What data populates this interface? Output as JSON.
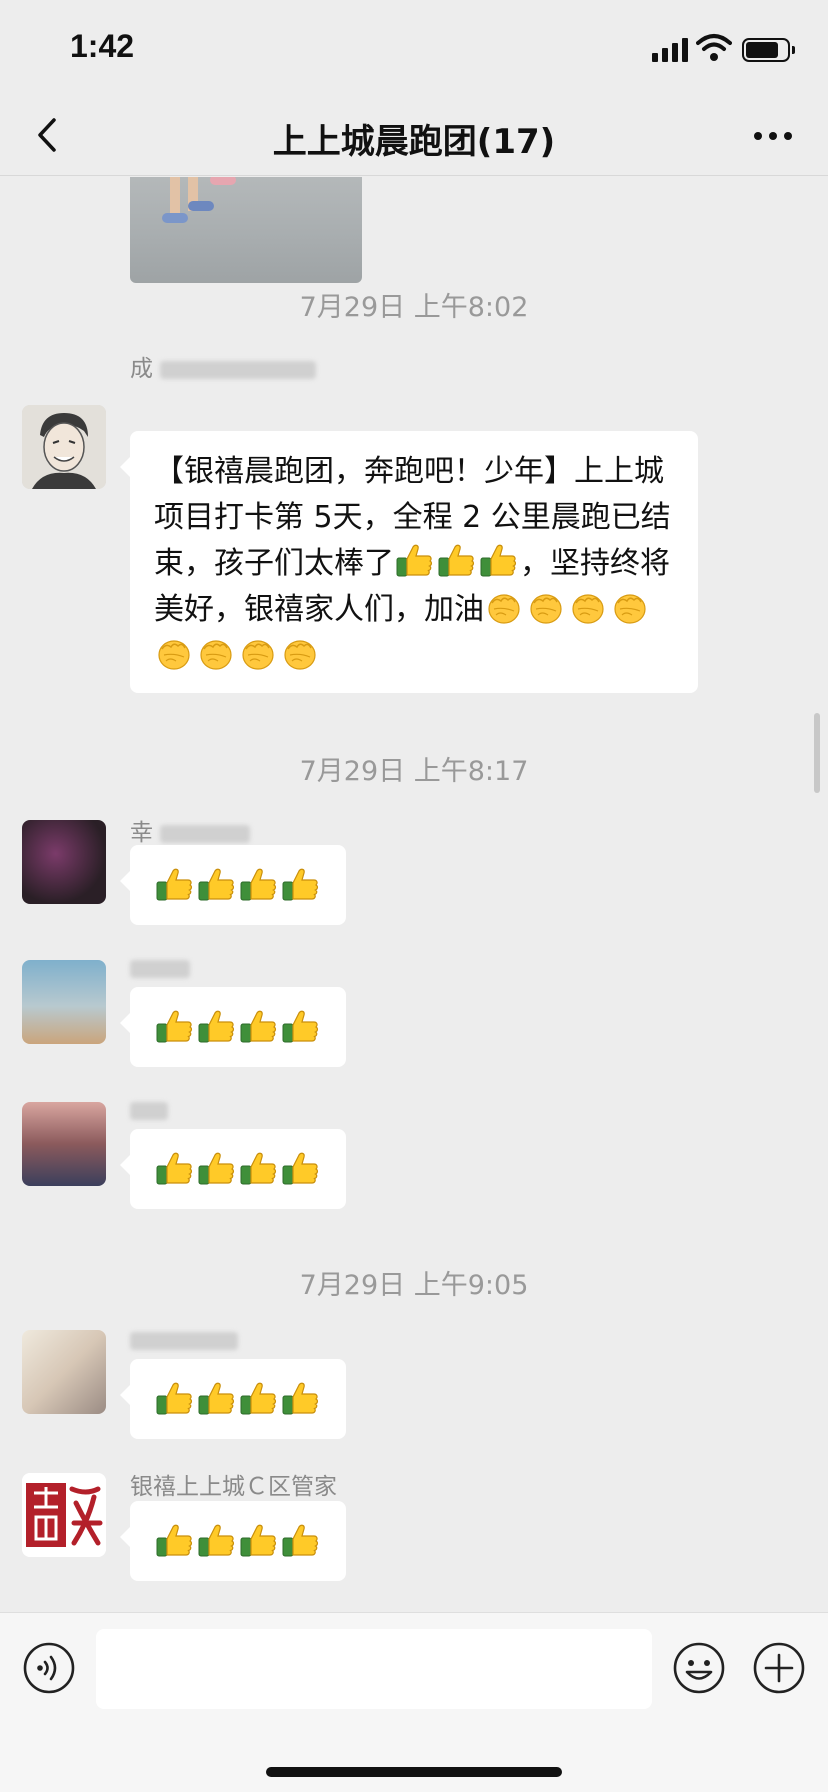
{
  "status_bar": {
    "time": "1:42"
  },
  "nav": {
    "title": "上上城晨跑团(17)"
  },
  "photo_message": {
    "sender": ""
  },
  "messages": [
    {
      "timestamp": "7月29日 上午8:02",
      "sender_visible": "成",
      "text": "【银禧晨跑团，奔跑吧！少年】上上城项目打卡第 5天，全程 2 公里晨跑已结束，孩子们太棒了",
      "text_tail": "，坚持终将美好，银禧家人们，加油",
      "thumbs_inline": 3,
      "fists": 8
    },
    {
      "timestamp": "7月29日 上午8:17",
      "group": [
        {
          "sender_visible": "幸",
          "thumbs": 4
        },
        {
          "sender_visible": "",
          "thumbs": 4
        },
        {
          "sender_visible": "",
          "thumbs": 4
        }
      ]
    },
    {
      "timestamp": "7月29日 上午9:05",
      "group": [
        {
          "sender_visible": "",
          "thumbs": 4
        },
        {
          "sender_visible": "银禧上上城Ｃ区管家",
          "thumbs": 4
        }
      ]
    }
  ],
  "input": {
    "placeholder": ""
  },
  "icons": [
    "back-icon",
    "more-icon",
    "voice-icon",
    "emoji-icon",
    "plus-icon",
    "thumbs-up-icon",
    "fist-icon"
  ],
  "colors": {
    "background": "#ededed",
    "bubble": "#ffffff",
    "timestamp": "#999999"
  }
}
